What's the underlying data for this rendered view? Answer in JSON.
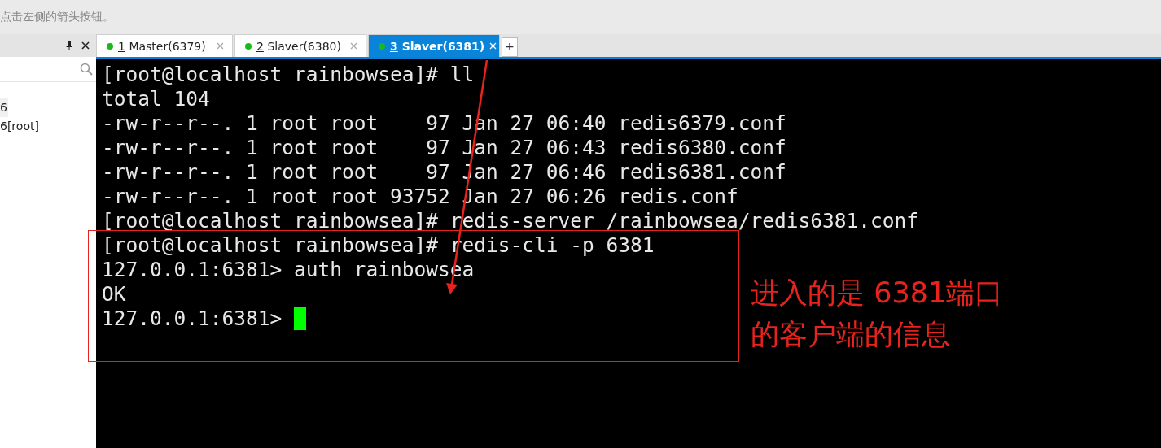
{
  "hint_bar": {
    "text": "点击左侧的箭头按钮。"
  },
  "sidebar": {
    "items": [
      {
        "label": "6",
        "selected": true
      },
      {
        "label": "6[root]",
        "selected": false
      }
    ]
  },
  "tabs": [
    {
      "number": "1",
      "label": "Master(6379)",
      "selected": false,
      "connected": true
    },
    {
      "number": "2",
      "label": "Slaver(6380)",
      "selected": false,
      "connected": true
    },
    {
      "number": "3",
      "label": "Slaver(6381)",
      "selected": true,
      "connected": true
    }
  ],
  "new_tab": {
    "label": "+"
  },
  "terminal": {
    "lines": [
      {
        "text": "[root@localhost rainbowsea]# ll",
        "cursor": false
      },
      {
        "text": "total 104",
        "cursor": false
      },
      {
        "text": "-rw-r--r--. 1 root root    97 Jan 27 06:40 redis6379.conf",
        "cursor": false
      },
      {
        "text": "-rw-r--r--. 1 root root    97 Jan 27 06:43 redis6380.conf",
        "cursor": false
      },
      {
        "text": "-rw-r--r--. 1 root root    97 Jan 27 06:46 redis6381.conf",
        "cursor": false
      },
      {
        "text": "-rw-r--r--. 1 root root 93752 Jan 27 06:26 redis.conf",
        "cursor": false
      },
      {
        "text": "[root@localhost rainbowsea]# redis-server /rainbowsea/redis6381.conf",
        "cursor": false
      },
      {
        "text": "[root@localhost rainbowsea]# redis-cli -p 6381",
        "cursor": false
      },
      {
        "text": "127.0.0.1:6381> auth rainbowsea",
        "cursor": false
      },
      {
        "text": "OK",
        "cursor": false
      },
      {
        "text": "127.0.0.1:6381> ",
        "cursor": true
      }
    ]
  },
  "annotation": {
    "lines": [
      "进入的是 6381端口",
      "的客户端的信息"
    ]
  }
}
